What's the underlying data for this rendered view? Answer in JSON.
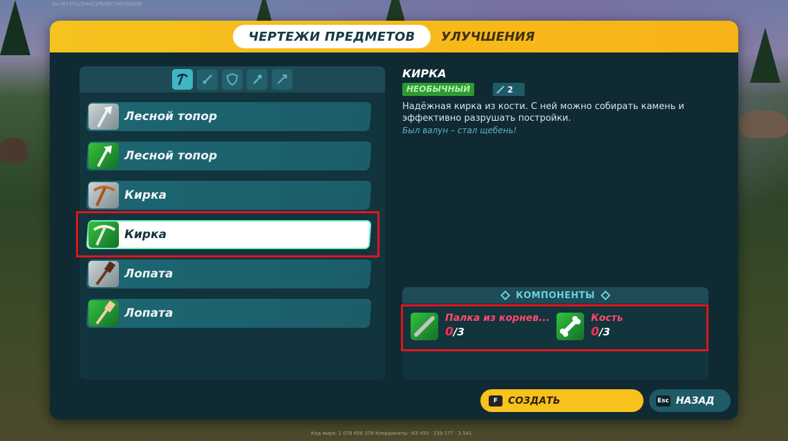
{
  "meta": {
    "world_id": "bcc9f72f3a7b4451f9d9b754f1fdd2f0",
    "footer": "Код мира: 1 078 656 376     Координаты: -63 450 · 239 177 · 3 541"
  },
  "tabs": [
    {
      "label": "ЧЕРТЕЖИ ПРЕДМЕТОВ",
      "active": true
    },
    {
      "label": "УЛУЧШЕНИЯ",
      "active": false
    }
  ],
  "filters": [
    {
      "icon": "pickaxe-icon",
      "active": true
    },
    {
      "icon": "sword-icon",
      "active": false
    },
    {
      "icon": "shield-icon",
      "active": false
    },
    {
      "icon": "torch-icon",
      "active": false
    },
    {
      "icon": "arrow-icon",
      "active": false
    }
  ],
  "recipes": [
    {
      "label": "Лесной топор",
      "rarity": "grey",
      "icon": "axe-icon"
    },
    {
      "label": "Лесной топор",
      "rarity": "green",
      "icon": "axe-icon"
    },
    {
      "label": "Кирка",
      "rarity": "grey",
      "icon": "pickaxe-icon"
    },
    {
      "label": "Кирка",
      "rarity": "green",
      "icon": "pickaxe-icon",
      "selected": true
    },
    {
      "label": "Лопата",
      "rarity": "grey",
      "icon": "shovel-icon"
    },
    {
      "label": "Лопата",
      "rarity": "green",
      "icon": "shovel-icon"
    }
  ],
  "detail": {
    "title": "КИРКА",
    "rarity": "НЕОБЫЧНЫЙ",
    "power": "2",
    "description": "Надёжная кирка из кости. С ней можно собирать камень и эффективно разрушать постройки.",
    "flavor": "Был валун – стал щебень!"
  },
  "components": {
    "header": "КОМПОНЕНТЫ",
    "items": [
      {
        "name": "Палка из корнев...",
        "have": "0",
        "need": "/3",
        "icon": "stick-icon"
      },
      {
        "name": "Кость",
        "have": "0",
        "need": "/3",
        "icon": "bone-icon"
      }
    ]
  },
  "actions": {
    "create": {
      "key": "F",
      "label": "СОЗДАТЬ"
    },
    "back": {
      "key": "Esc",
      "label": "НАЗАД"
    }
  },
  "colors": {
    "accent_yellow": "#f6c21e",
    "panel": "#0f2a33",
    "highlight_red": "#e3141c",
    "rarity_green": "#2f9a34"
  }
}
